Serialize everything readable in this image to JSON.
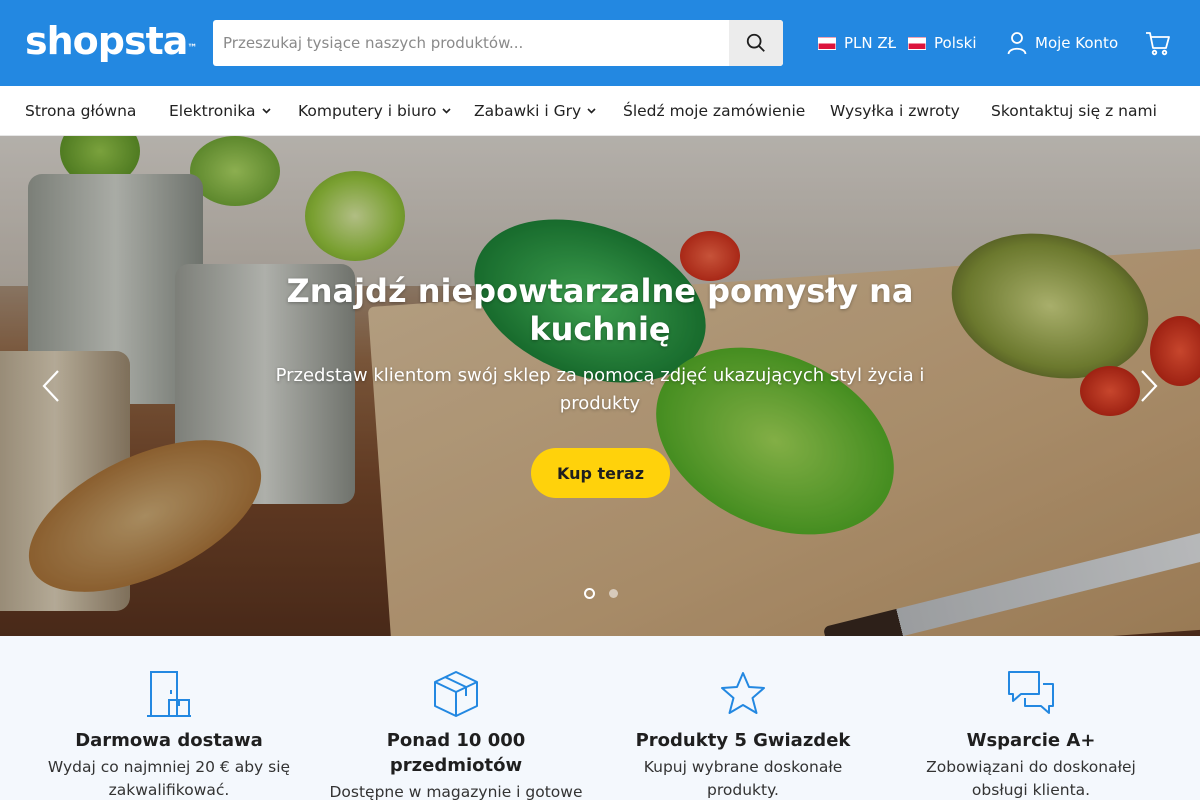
{
  "header": {
    "logo": "shopsta",
    "logo_tm": "™",
    "search_placeholder": "Przeszukaj tysiące naszych produktów...",
    "currency": "PLN ZŁ",
    "language": "Polski",
    "account": "Moje Konto"
  },
  "nav": {
    "items": [
      {
        "label": "Strona główna"
      },
      {
        "label": "Elektronika"
      },
      {
        "label": "Komputery i biuro"
      },
      {
        "label": "Zabawki i Gry"
      },
      {
        "label": "Śledź moje zamówienie"
      },
      {
        "label": "Wysyłka i zwroty"
      },
      {
        "label": "Skontaktuj się z nami"
      }
    ]
  },
  "hero": {
    "title": "Znajdź niepowtarzalne pomysły na kuchnię",
    "subtitle": "Przedstaw klientom swój sklep za pomocą zdjęć ukazujących styl życia i produkty",
    "button": "Kup teraz",
    "slide_count": 2,
    "active_slide": 1
  },
  "features": [
    {
      "icon": "delivery-door-icon",
      "title": "Darmowa dostawa",
      "text": "Wydaj co najmniej 20 € aby się zakwalifikować."
    },
    {
      "icon": "box-icon",
      "title": "Ponad 10 000 przedmiotów",
      "text": "Dostępne w magazynie i gotowe"
    },
    {
      "icon": "star-icon",
      "title": "Produkty 5 Gwiazdek",
      "text": "Kupuj wybrane doskonałe produkty."
    },
    {
      "icon": "chat-bubbles-icon",
      "title": "Wsparcie A+",
      "text": "Zobowiązani do doskonałej obsługi klienta."
    }
  ],
  "colors": {
    "header_bg": "#2388e1",
    "accent_yellow": "#ffd20b",
    "icon_blue": "#2388e1",
    "features_bg": "#f4f8fd"
  }
}
